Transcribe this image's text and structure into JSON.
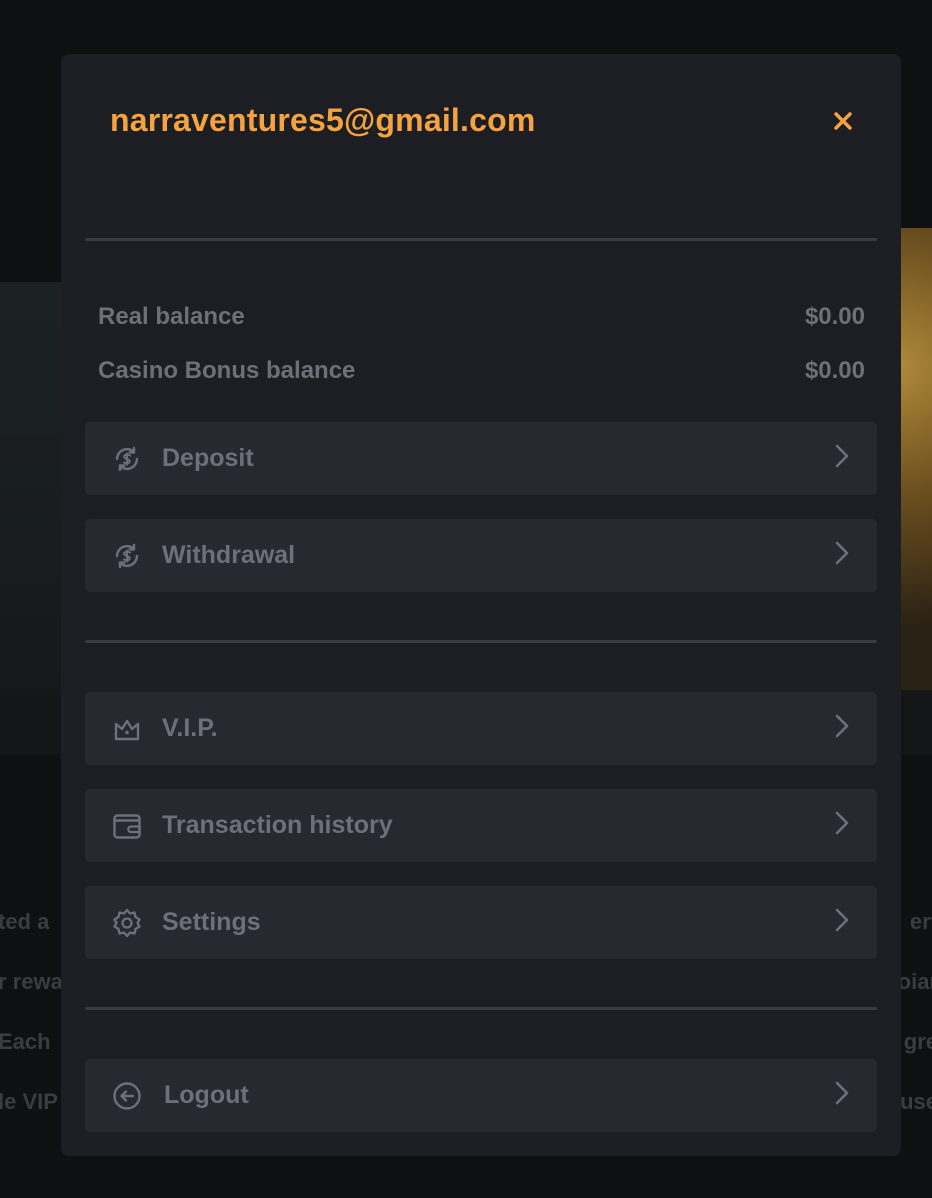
{
  "account": {
    "email": "narraventures5@gmail.com"
  },
  "balances": [
    {
      "label": "Real balance",
      "value": "$0.00"
    },
    {
      "label": "Casino Bonus balance",
      "value": "$0.00"
    }
  ],
  "menu": {
    "deposit": "Deposit",
    "withdrawal": "Withdrawal",
    "vip": "V.I.P.",
    "transaction_history": "Transaction history",
    "settings": "Settings",
    "logout": "Logout"
  },
  "background_text": {
    "left": [
      "ted a",
      "r rewa",
      "Each",
      "le VIP"
    ],
    "right": [
      "ert",
      "oiar",
      "gre",
      "use"
    ]
  },
  "colors": {
    "accent": "#f4a340",
    "panel": "#1d1e23",
    "row": "#272931",
    "muted_text": "#6e7079"
  }
}
